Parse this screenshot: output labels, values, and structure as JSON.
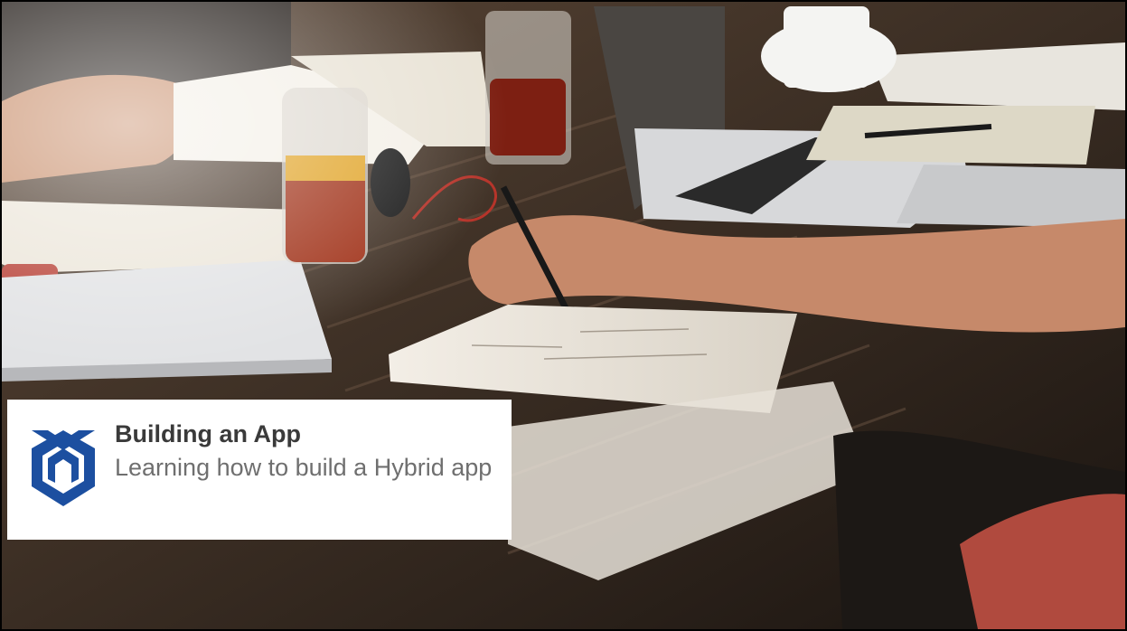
{
  "slide": {
    "title": "Building an App",
    "subtitle": "Learning how to build a Hybrid app"
  },
  "logo": {
    "icon": "brand-logo-icon",
    "color": "#1c4fa0"
  },
  "photo": {
    "subject": "people working at wooden table with laptops, notebooks and drinks"
  }
}
